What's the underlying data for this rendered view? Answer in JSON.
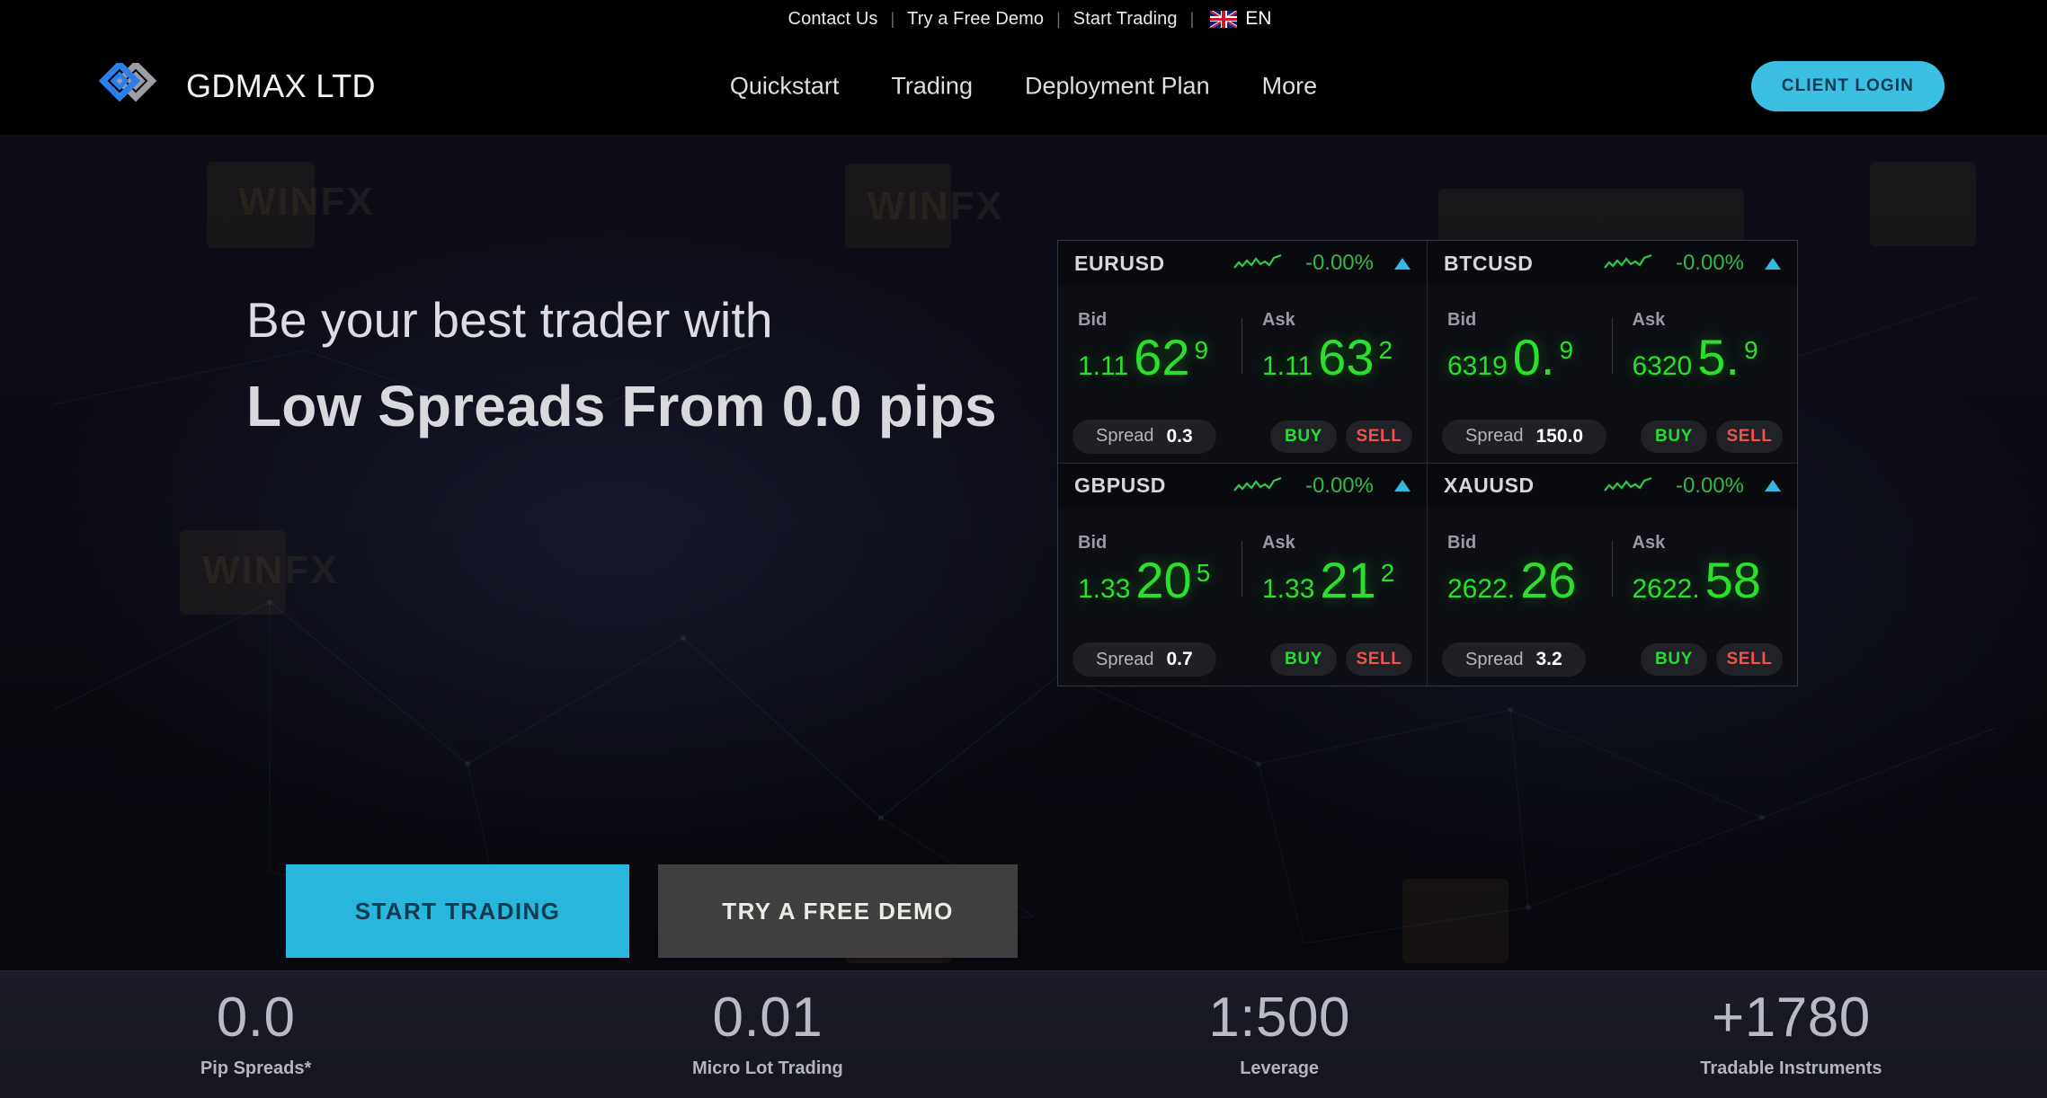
{
  "topbar": {
    "links": [
      "Contact Us",
      "Try a Free Demo",
      "Start Trading"
    ],
    "separator": "|",
    "language": "EN",
    "flag_icon": "uk-flag-icon"
  },
  "header": {
    "brand": "GDMAX LTD",
    "logo_icon": "double-diamond-logo-icon",
    "nav": [
      "Quickstart",
      "Trading",
      "Deployment Plan",
      "More"
    ],
    "login_label": "CLIENT LOGIN",
    "accent": "#3bbfe3"
  },
  "hero": {
    "subheading": "Be your best trader with",
    "heading": "Low Spreads From 0.0 pips",
    "cta_primary": "START TRADING",
    "cta_secondary": "TRY A FREE DEMO"
  },
  "widget": {
    "bid_label": "Bid",
    "ask_label": "Ask",
    "spread_label": "Spread",
    "buy_label": "BUY",
    "sell_label": "SELL",
    "change_color": "#35b64a",
    "price_color": "#2ae02a",
    "buy_color": "#24dd32",
    "sell_color": "#f0514d",
    "tiles": [
      {
        "symbol": "EURUSD",
        "change": "-0.00%",
        "direction": "up",
        "bid": {
          "small": "1.11",
          "big": "62",
          "sup": "9"
        },
        "ask": {
          "small": "1.11",
          "big": "63",
          "sup": "2"
        },
        "spread": "0.3"
      },
      {
        "symbol": "BTCUSD",
        "change": "-0.00%",
        "direction": "up",
        "bid": {
          "small": "6319",
          "big": "0.",
          "sup": "9"
        },
        "ask": {
          "small": "6320",
          "big": "5.",
          "sup": "9"
        },
        "spread": "150.0"
      },
      {
        "symbol": "GBPUSD",
        "change": "-0.00%",
        "direction": "up",
        "bid": {
          "small": "1.33",
          "big": "20",
          "sup": "5"
        },
        "ask": {
          "small": "1.33",
          "big": "21",
          "sup": "2"
        },
        "spread": "0.7"
      },
      {
        "symbol": "XAUUSD",
        "change": "-0.00%",
        "direction": "up",
        "bid": {
          "small": "2622.",
          "big": "26",
          "sup": ""
        },
        "ask": {
          "small": "2622.",
          "big": "58",
          "sup": ""
        },
        "spread": "3.2"
      }
    ]
  },
  "stats": [
    {
      "value": "0.0",
      "label": "Pip Spreads*"
    },
    {
      "value": "0.01",
      "label": "Micro Lot Trading"
    },
    {
      "value": "1:500",
      "label": "Leverage"
    },
    {
      "value": "+1780",
      "label": "Tradable Instruments"
    }
  ]
}
